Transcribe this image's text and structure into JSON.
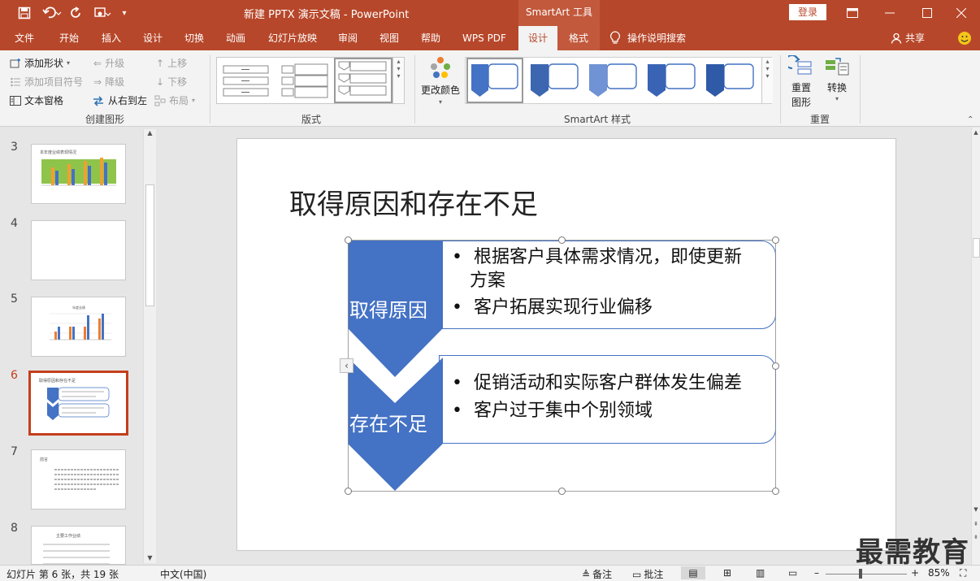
{
  "titlebar": {
    "doc_title": "新建 PPTX 演示文稿 - PowerPoint",
    "tool_group": "SmartArt 工具",
    "login": "登录",
    "icons": [
      "save-icon",
      "undo-icon",
      "redo-icon",
      "touch-mode-icon",
      "customize-icon"
    ]
  },
  "tabs": [
    "文件",
    "开始",
    "插入",
    "设计",
    "切换",
    "动画",
    "幻灯片放映",
    "审阅",
    "视图",
    "帮助",
    "WPS PDF",
    "设计",
    "格式"
  ],
  "tell_me": "操作说明搜索",
  "share": "共享",
  "ribbon": {
    "create": {
      "add_shape": "添加形状",
      "add_bullet": "添加项目符号",
      "text_pane": "文本窗格",
      "promote": "升级",
      "demote": "降级",
      "rtl": "从右到左",
      "move_up": "上移",
      "move_down": "下移",
      "layout": "布局",
      "group_label": "创建图形"
    },
    "layouts_label": "版式",
    "change_colors": "更改颜色",
    "styles_label": "SmartArt 样式",
    "reset": {
      "reset_graphic_1": "重置",
      "reset_graphic_2": "图形",
      "convert": "转换",
      "group_label": "重置"
    },
    "accent_color": "#4472c4"
  },
  "thumbs": [
    {
      "num": "3",
      "title": "本年度业绩表现情况"
    },
    {
      "num": "4",
      "title": ""
    },
    {
      "num": "5",
      "title": "年度业绩"
    },
    {
      "num": "6",
      "title": "取得原因和存在不足"
    },
    {
      "num": "7",
      "title": "前言"
    },
    {
      "num": "8",
      "title": "主要工作业绩"
    }
  ],
  "slide": {
    "title": "取得原因和存在不足",
    "items": [
      {
        "label": "取得原因",
        "bullets": [
          "根据客户具体需求情况，即使更新",
          "方案",
          "客户拓展实现行业偏移"
        ]
      },
      {
        "label": "存在不足",
        "bullets": [
          "促销活动和实际客户群体发生偏差",
          "客户过于集中个别领域"
        ]
      }
    ]
  },
  "status": {
    "slide_info": "幻灯片 第 6 张，共 19 张",
    "language": "中文(中国)",
    "notes": "备注",
    "comments": "批注",
    "zoom_level": "85%"
  },
  "watermark": "最需教育"
}
